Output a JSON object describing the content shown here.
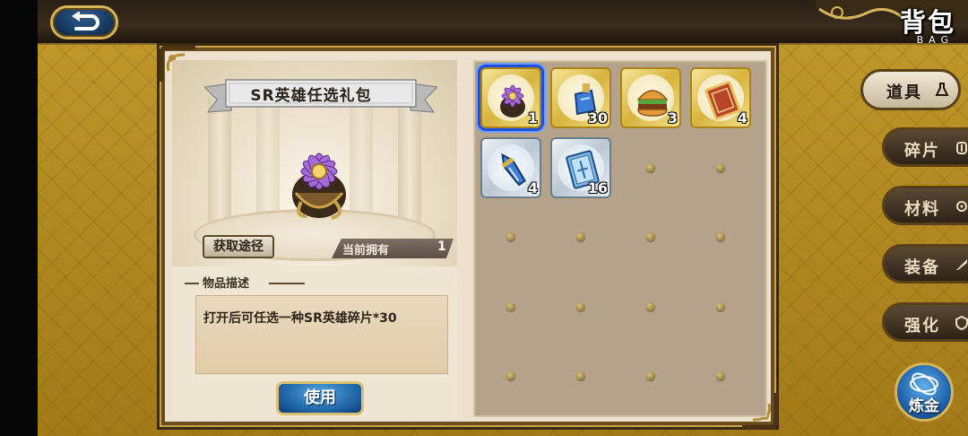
{
  "header": {
    "title_cn": "背包",
    "title_en": "BAG",
    "back_icon": "back-arrow-icon"
  },
  "detail": {
    "item_name": "SR英雄任选礼包",
    "source_button": "获取途径",
    "owned_label": "当前拥有",
    "owned_count": "1",
    "desc_title": "物品描述",
    "desc_text": "打开后可任选一种SR英雄碎片*30",
    "use_button": "使用"
  },
  "inventory": {
    "items": [
      {
        "icon": "sr-hero-pack-icon",
        "qty": "1",
        "frame": "gold",
        "selected": true
      },
      {
        "icon": "blue-potion-icon",
        "qty": "30",
        "frame": "gold",
        "selected": false
      },
      {
        "icon": "burger-icon",
        "qty": "3",
        "frame": "gold",
        "selected": false
      },
      {
        "icon": "gold-ticket-icon",
        "qty": "4",
        "frame": "gold",
        "selected": false
      },
      {
        "icon": "blue-crystal-icon",
        "qty": "4",
        "frame": "silver",
        "selected": false
      },
      {
        "icon": "blue-card-icon",
        "qty": "16",
        "frame": "silver",
        "selected": false
      }
    ],
    "empty_slots": 14
  },
  "tabs": [
    {
      "label": "道具",
      "icon": "flask-icon",
      "active": true
    },
    {
      "label": "碎片",
      "icon": "shard-icon",
      "active": false
    },
    {
      "label": "材料",
      "icon": "gear-icon",
      "active": false
    },
    {
      "label": "装备",
      "icon": "weapon-icon",
      "active": false
    },
    {
      "label": "强化",
      "icon": "shield-icon",
      "active": false
    }
  ],
  "alchemy_button": "炼金",
  "colors": {
    "selected_border": "#1f4fe0",
    "gold_frame": "#d7b33c",
    "use_button": "#1c5fa0"
  }
}
